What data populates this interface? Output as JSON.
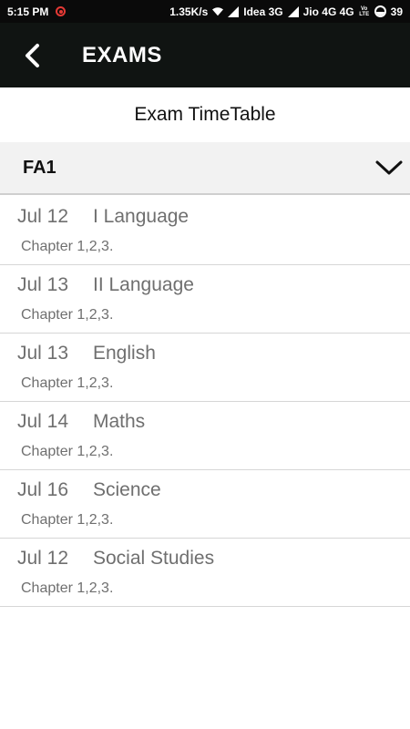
{
  "status_bar": {
    "time": "5:15 PM",
    "speed": "1.35K/s",
    "carrier1": "Idea 3G",
    "carrier2": "Jio 4G 4G",
    "volte_line1": "Vo",
    "volte_line2": "LTE",
    "battery": "39"
  },
  "app_bar": {
    "title": "EXAMS",
    "back_icon": "back-arrow-icon"
  },
  "subtitle": "Exam TimeTable",
  "section": {
    "title": "FA1",
    "expand_icon": "chevron-down-icon"
  },
  "exams": [
    {
      "date": "Jul 12",
      "subject": "I Language",
      "syllabus": "Chapter 1,2,3."
    },
    {
      "date": "Jul 13",
      "subject": "II Language",
      "syllabus": "Chapter 1,2,3."
    },
    {
      "date": "Jul 13",
      "subject": "English",
      "syllabus": "Chapter 1,2,3."
    },
    {
      "date": "Jul 14",
      "subject": "Maths",
      "syllabus": "Chapter 1,2,3."
    },
    {
      "date": "Jul 16",
      "subject": "Science",
      "syllabus": "Chapter 1,2,3."
    },
    {
      "date": "Jul 12",
      "subject": "Social Studies",
      "syllabus": "Chapter 1,2,3."
    }
  ],
  "colors": {
    "app_bar": "#101412",
    "status_bar": "#0a0a0a",
    "section_bg": "#f2f2f2",
    "item_text": "#6f6f6f"
  }
}
